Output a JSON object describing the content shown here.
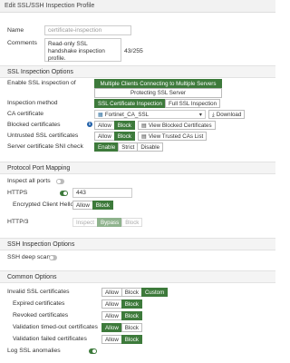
{
  "window": {
    "title": "Edit SSL/SSH Inspection Profile"
  },
  "general": {
    "name_label": "Name",
    "name_value": "certificate-inspection",
    "comments_label": "Comments",
    "comments_value": "Read-only SSL handshake inspection profile.",
    "comments_count": "43/255"
  },
  "ssl_options": {
    "header": "SSL Inspection Options",
    "enable_label": "Enable SSL inspection of",
    "enable_options": [
      "Multiple Clients Connecting to Multiple Servers",
      "Protecting SSL Server"
    ],
    "method_label": "Inspection method",
    "method_options": [
      "SSL Certificate Inspection",
      "Full SSL Inspection"
    ],
    "ca_label": "CA certificate",
    "ca_value": "Fortinet_CA_SSL",
    "download_label": "Download",
    "blocked_label": "Blocked certificates",
    "blocked_options": [
      "Allow",
      "Block"
    ],
    "view_blocked_label": "View Blocked Certificates",
    "untrusted_label": "Untrusted SSL certificates",
    "untrusted_options": [
      "Allow",
      "Block"
    ],
    "view_trusted_label": "View Trusted CAs List",
    "sni_label": "Server certificate SNI check",
    "sni_options": [
      "Enable",
      "Strict",
      "Disable"
    ]
  },
  "port_mapping": {
    "header": "Protocol Port Mapping",
    "inspect_all_label": "Inspect all ports",
    "https_label": "HTTPS",
    "https_port": "443",
    "ech_label": "Encrypted Client Hello",
    "ech_options": [
      "Allow",
      "Block"
    ],
    "http3_label": "HTTP/3",
    "http3_options": [
      "Inspect",
      "Bypass",
      "Block"
    ]
  },
  "ssh_options": {
    "header": "SSH Inspection Options",
    "deep_scan_label": "SSH deep scan"
  },
  "common": {
    "header": "Common Options",
    "invalid_label": "Invalid SSL certificates",
    "invalid_options": [
      "Allow",
      "Block",
      "Custom"
    ],
    "expired_label": "Expired certificates",
    "revoked_label": "Revoked certificates",
    "timeout_label": "Validation timed-out certificates",
    "failed_label": "Validation failed certificates",
    "allow_block": [
      "Allow",
      "Block"
    ],
    "log_label": "Log SSL anomalies"
  },
  "colors": {
    "accent": "#3d7a3b",
    "info": "#1f5fa8"
  }
}
